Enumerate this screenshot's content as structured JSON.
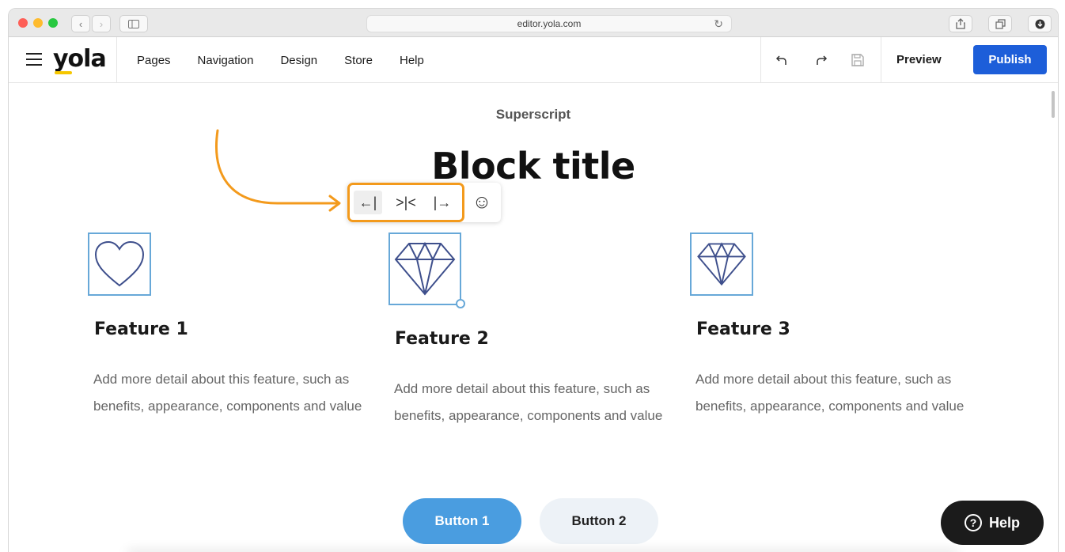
{
  "browser": {
    "url": "editor.yola.com",
    "back_glyph": "‹",
    "forward_glyph": "›",
    "reload_glyph": "↻"
  },
  "header": {
    "logo": "yola",
    "nav": [
      "Pages",
      "Navigation",
      "Design",
      "Store",
      "Help"
    ],
    "preview_label": "Preview",
    "publish_label": "Publish",
    "icons": [
      "undo-icon",
      "redo-icon",
      "save-icon"
    ]
  },
  "content": {
    "superscript": "Superscript",
    "title": "Block title",
    "align_toolbar": {
      "left_glyph": "←|",
      "center_glyph": ">|<",
      "right_glyph": "|→",
      "emoji_glyph": "☺"
    },
    "features": [
      {
        "title": "Feature 1",
        "desc": "Add more detail about this feature, such as benefits, appearance, components and value",
        "icon": "heart-icon"
      },
      {
        "title": "Feature 2",
        "desc": "Add more detail about this feature, such as benefits, appearance, components and value",
        "icon": "diamond-icon"
      },
      {
        "title": "Feature 3",
        "desc": "Add more detail about this feature, such as benefits, appearance, components and value",
        "icon": "diamond-icon"
      }
    ],
    "button1": "Button 1",
    "button2": "Button 2"
  },
  "help_fab": {
    "label": "Help",
    "glyph": "?"
  },
  "colors": {
    "accent_orange": "#f39a1c",
    "publish_blue": "#1d5ed9",
    "icon_border": "#67a8d8",
    "button1_blue": "#4a9de0"
  }
}
